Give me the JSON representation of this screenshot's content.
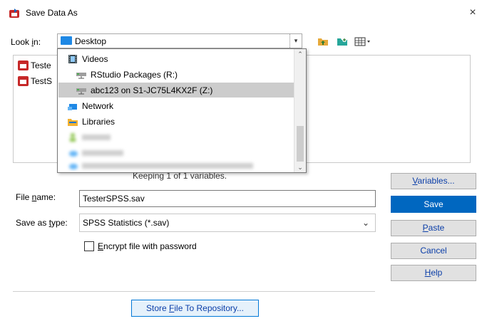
{
  "dialog": {
    "title": "Save Data As",
    "close_glyph": "×",
    "icon": "spss-save-icon"
  },
  "look_in": {
    "label_prefix": "Look ",
    "label_accel": "i",
    "label_suffix": "n:",
    "value": "Desktop",
    "arrow": "▾"
  },
  "dropdown": {
    "items": [
      {
        "label": "Videos",
        "icon": "film-icon"
      },
      {
        "label": "RStudio Packages (R:)",
        "icon": "network-drive-icon"
      },
      {
        "label": "abc123 on S1-JC75L4KX2F (Z:)",
        "icon": "network-drive-icon",
        "selected": true
      },
      {
        "label": "Network",
        "icon": "network-icon"
      },
      {
        "label": "Libraries",
        "icon": "libraries-icon"
      },
      {
        "label": "",
        "icon": "user-folder-icon",
        "obscured": true
      },
      {
        "label": "",
        "icon": "onedrive-icon",
        "obscured": true
      },
      {
        "label": "",
        "icon": "onedrive-icon",
        "obscured": true
      }
    ]
  },
  "file_list": {
    "items": [
      {
        "label": "Teste",
        "icon": "spss-data-file-icon"
      },
      {
        "label": "TestS",
        "icon": "spss-data-file-icon"
      }
    ]
  },
  "keeping_text": "Keeping 1 of 1 variables.",
  "file_name": {
    "label_prefix": "File ",
    "label_accel": "n",
    "label_suffix": "ame:",
    "value": "TesterSPSS.sav"
  },
  "save_as_type": {
    "label_prefix": "Save as ",
    "label_accel": "t",
    "label_suffix": "ype:",
    "value": "SPSS Statistics (*.sav)",
    "arrow": "⌄"
  },
  "encrypt": {
    "label_accel": "E",
    "label_rest": "ncrypt file with password",
    "checked": false
  },
  "buttons": {
    "variables": {
      "accel": "V",
      "rest": "ariables..."
    },
    "save": "Save",
    "paste": {
      "accel": "P",
      "rest": "aste"
    },
    "cancel": "Cancel",
    "help": {
      "accel": "H",
      "rest": "elp"
    }
  },
  "store": {
    "prefix": "Store ",
    "accel": "F",
    "rest": "ile To Repository..."
  },
  "colors": {
    "accent": "#0067c0",
    "selection": "#cccccc"
  }
}
